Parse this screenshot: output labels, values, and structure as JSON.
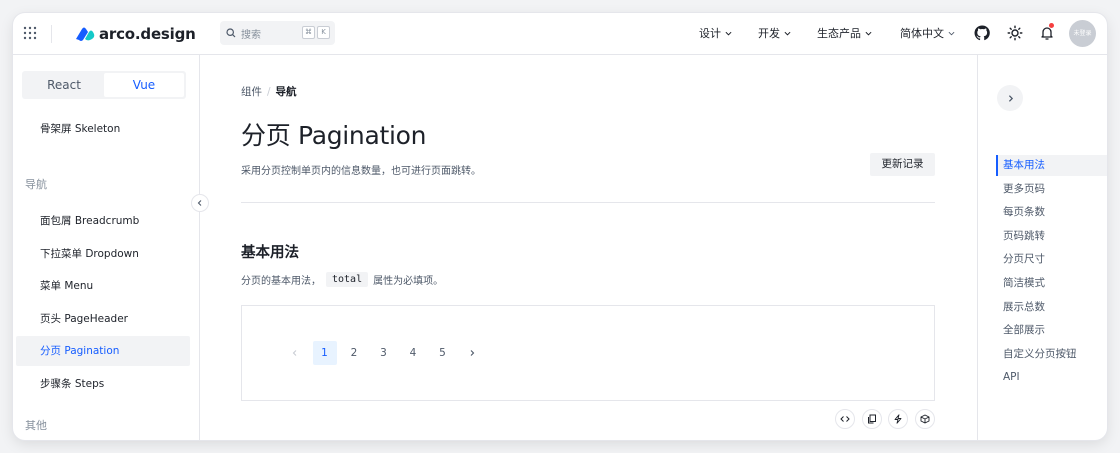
{
  "header": {
    "brand": "arco.design",
    "search_placeholder": "搜索",
    "shortcut_keys": [
      "⌘",
      "K"
    ],
    "nav": [
      {
        "label": "设计"
      },
      {
        "label": "开发"
      },
      {
        "label": "生态产品"
      },
      {
        "label": "简体中文"
      }
    ],
    "avatar_text": "未登录"
  },
  "sidebar": {
    "framework_switch": [
      "React",
      "Vue"
    ],
    "framework_active": "Vue",
    "items": [
      {
        "label": "骨架屏 Skeleton",
        "type": "item"
      },
      {
        "label": "导航",
        "type": "group"
      },
      {
        "label": "面包屑 Breadcrumb",
        "type": "item"
      },
      {
        "label": "下拉菜单 Dropdown",
        "type": "item"
      },
      {
        "label": "菜单 Menu",
        "type": "item"
      },
      {
        "label": "页头 PageHeader",
        "type": "item"
      },
      {
        "label": "分页 Pagination",
        "type": "item",
        "active": true
      },
      {
        "label": "步骤条 Steps",
        "type": "item"
      },
      {
        "label": "其他",
        "type": "group"
      }
    ]
  },
  "main": {
    "breadcrumb": [
      "组件",
      "导航"
    ],
    "title": "分页 Pagination",
    "description": "采用分页控制单页内的信息数量，也可进行页面跳转。",
    "changelog_label": "更新记录",
    "section": {
      "title": "基本用法",
      "desc_before": "分页的基本用法，",
      "desc_code": "total",
      "desc_after": "属性为必填项。"
    },
    "pagination": {
      "pages": [
        "1",
        "2",
        "3",
        "4",
        "5"
      ],
      "current": "1"
    },
    "demo_tools": [
      "code-icon",
      "copy-icon",
      "codepen-icon",
      "codesandbox-icon"
    ]
  },
  "toc": {
    "items": [
      {
        "label": "基本用法",
        "active": true
      },
      {
        "label": "更多页码"
      },
      {
        "label": "每页条数"
      },
      {
        "label": "页码跳转"
      },
      {
        "label": "分页尺寸"
      },
      {
        "label": "简洁模式"
      },
      {
        "label": "展示总数"
      },
      {
        "label": "全部展示"
      },
      {
        "label": "自定义分页按钮"
      },
      {
        "label": "API"
      }
    ]
  },
  "colors": {
    "primary": "#165dff",
    "text": "#1d2129",
    "muted": "#86909c",
    "border": "#e5e6eb",
    "fill": "#f2f3f5",
    "notification": "#f53f3f"
  }
}
